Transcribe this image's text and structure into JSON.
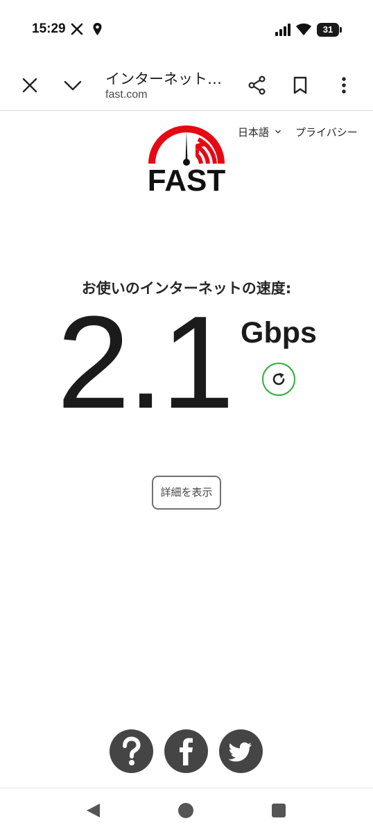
{
  "status_bar": {
    "time": "15:29",
    "battery": "31",
    "icons": [
      "x-app-icon",
      "location-pin-icon",
      "cell-signal-icon",
      "wifi-icon",
      "battery-icon"
    ]
  },
  "toolbar": {
    "title": "インターネット…",
    "url": "fast.com",
    "icons": [
      "close-icon",
      "chevron-down-icon",
      "share-icon",
      "bookmark-icon",
      "more-vert-icon"
    ]
  },
  "header": {
    "language": "日本語",
    "privacy": "プライバシー"
  },
  "logo": {
    "text": "FAST",
    "brand_color": "#e50914"
  },
  "speed": {
    "label": "お使いのインターネットの速度:",
    "value": "2.1",
    "unit": "Gbps",
    "refresh_color": "#2fae3a"
  },
  "details_button": "詳細を表示",
  "social": [
    "help-icon",
    "facebook-icon",
    "twitter-icon"
  ],
  "navbar": [
    "nav-back-icon",
    "nav-home-icon",
    "nav-recents-icon"
  ]
}
